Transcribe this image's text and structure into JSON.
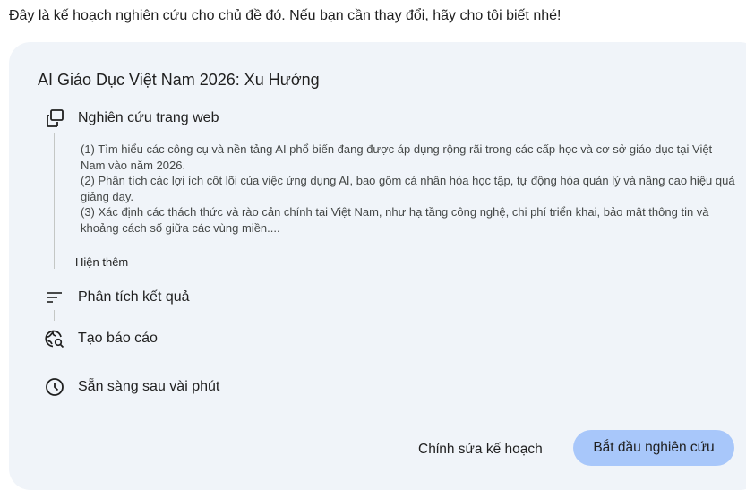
{
  "intro_text": "Đây là kế hoạch nghiên cứu cho chủ đề đó. Nếu bạn cần thay đổi, hãy cho tôi biết nhé!",
  "plan": {
    "title": "AI Giáo Dục Việt Nam 2026: Xu Hướng",
    "steps": [
      {
        "label": "Nghiên cứu trang web",
        "icon": "web-pages-icon"
      },
      {
        "label": "Phân tích kết quả",
        "icon": "analysis-lines-icon"
      },
      {
        "label": "Tạo báo cáo",
        "icon": "globe-search-icon"
      },
      {
        "label": "Sẵn sàng sau vài phút",
        "icon": "clock-icon"
      }
    ],
    "details": [
      "(1) Tìm hiểu các công cụ và nền tảng AI phổ biến đang được áp dụng rộng rãi trong các cấp học và cơ sở giáo dục tại Việt Nam vào năm 2026.",
      "(2) Phân tích các lợi ích cốt lõi của việc ứng dụng AI, bao gồm cá nhân hóa học tập, tự động hóa quản lý và nâng cao hiệu quả giảng dạy.",
      "(3) Xác định các thách thức và rào cản chính tại Việt Nam, như hạ tầng công nghệ, chi phí triển khai, bảo mật thông tin và khoảng cách số giữa các vùng miền...."
    ],
    "show_more": "Hiện thêm"
  },
  "actions": {
    "edit_label": "Chỉnh sửa kế hoạch",
    "start_label": "Bắt đầu nghiên cứu"
  },
  "colors": {
    "card_background": "#f0f4f9",
    "primary_button": "#a8c7fa"
  }
}
